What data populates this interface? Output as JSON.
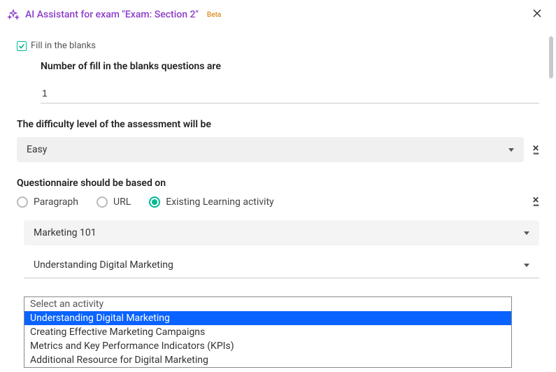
{
  "header": {
    "title": "AI Assistant for exam \"Exam: Section 2\"",
    "beta": "Beta"
  },
  "fill_blanks": {
    "checkbox_label": "Fill in the blanks",
    "count_label": "Number of fill in the blanks questions are",
    "count_value": "1"
  },
  "difficulty": {
    "label": "The difficulty level of the assessment will be",
    "value": "Easy"
  },
  "basis": {
    "label": "Questionnaire should be based on",
    "options": {
      "paragraph": "Paragraph",
      "url": "URL",
      "existing": "Existing Learning activity"
    },
    "course_value": "Marketing 101",
    "activity_value": "Understanding Digital Marketing",
    "dropdown": {
      "placeholder": "Select an activity",
      "items": [
        "Understanding Digital Marketing",
        "Creating Effective Marketing Campaigns",
        "Metrics and Key Performance Indicators (KPIs)",
        "Additional Resource for Digital Marketing"
      ]
    }
  }
}
